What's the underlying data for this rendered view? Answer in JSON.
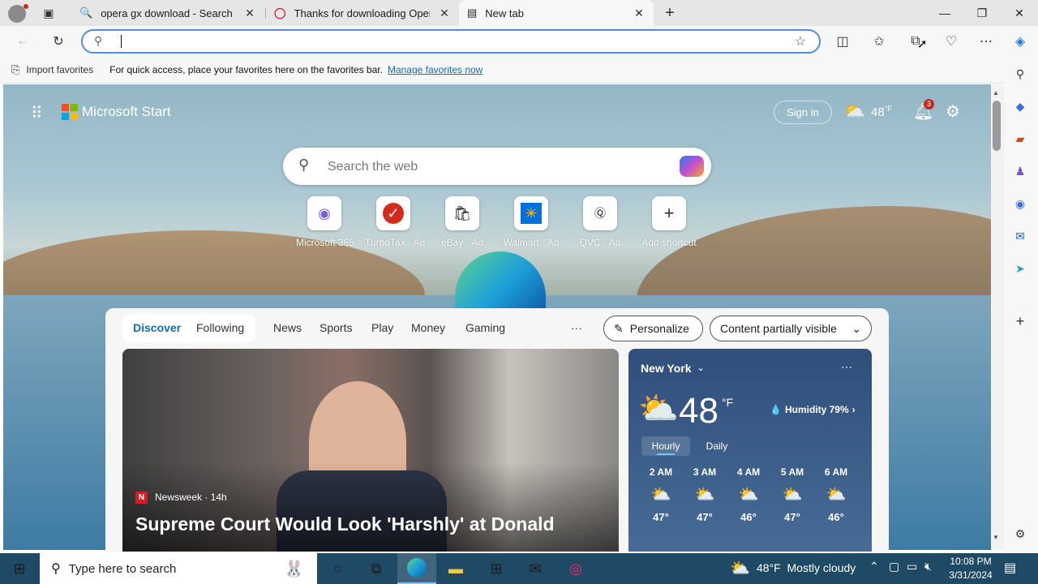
{
  "tabs": [
    {
      "title": "opera gx download - Search",
      "icon": "search-icon"
    },
    {
      "title": "Thanks for downloading Opera",
      "icon": "opera-icon"
    },
    {
      "title": "New tab",
      "icon": "newtab-icon",
      "active": true
    }
  ],
  "favorites_bar": {
    "import_label": "Import favorites",
    "hint": "For quick access, place your favorites here on the favorites bar.",
    "manage_link": "Manage favorites now"
  },
  "start": {
    "brand": "Microsoft Start",
    "sign_in": "Sign in",
    "temp": "48",
    "temp_unit": "°F",
    "notification_count": "3",
    "search_placeholder": "Search the web",
    "shortcuts": [
      {
        "label": "Microsoft 365",
        "ad": ""
      },
      {
        "label": "TurboTax",
        "ad": "· Ad"
      },
      {
        "label": "eBay",
        "ad": "· Ad"
      },
      {
        "label": "Walmart",
        "ad": "· Ad"
      },
      {
        "label": "QVC",
        "ad": "· Ad"
      },
      {
        "label": "Add shortcut",
        "ad": ""
      }
    ]
  },
  "feed": {
    "tabs": [
      "Discover",
      "Following",
      "News",
      "Sports",
      "Play",
      "Money",
      "Gaming"
    ],
    "more": "···",
    "personalize": "Personalize",
    "visibility": "Content partially visible",
    "hero": {
      "source": "Newsweek · 14h",
      "headline": "Supreme Court Would Look 'Harshly' at Donald"
    }
  },
  "weather": {
    "location": "New York",
    "temp": "48",
    "unit": "°F",
    "humidity": "Humidity 79%",
    "tabs": [
      "Hourly",
      "Daily"
    ],
    "hours": [
      {
        "time": "2 AM",
        "temp": "47°"
      },
      {
        "time": "3 AM",
        "temp": "47°"
      },
      {
        "time": "4 AM",
        "temp": "46°"
      },
      {
        "time": "5 AM",
        "temp": "47°"
      },
      {
        "time": "6 AM",
        "temp": "46°"
      }
    ]
  },
  "taskbar": {
    "search_placeholder": "Type here to search",
    "weather": "48°F  Mostly cloudy",
    "time": "10:08 PM",
    "date": "3/31/2024"
  },
  "colors": {
    "accent": "#0f6cbd",
    "link": "#0f6cbd",
    "taskbar": "#1f4a66"
  }
}
